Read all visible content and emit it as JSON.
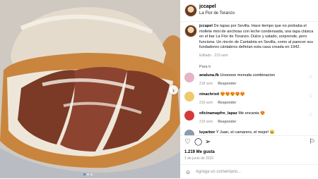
{
  "post": {
    "username": "jccapel",
    "location": "La Flor de Toranzo",
    "caption_user": "jccapel",
    "caption_text": "De tapas por Sevilla. Hace tiempo que no probaba el mollete mini de anchoas con leche condensada, una tapa clásica en el bar La Flor de Toranzo. Dulce y salado, sorprende, pero funciona. Un rincón de Cantabria en Sevilla, como al parecer sus fundadores cántabros definían esta casa creada en 1942.",
    "edited": "Editado · 219 sem",
    "translate": "Para ti",
    "likes": "1.219 Me gusta",
    "date": "1 de junio de 2022",
    "add_comment_placeholder": "Agrega un comentario..."
  },
  "comments": [
    {
      "user": "analuna.fb",
      "text": "Uoooooo menuda combinacion",
      "time": "218 sem",
      "reply": "Responder",
      "avatar_color": "#e7b3c8"
    },
    {
      "user": "ninachristi",
      "text": "😍😍😍😍😍",
      "time": "219 sem",
      "reply": "Responder",
      "avatar_color": "#f1c96a"
    },
    {
      "user": "oficinamapfre_lapaz",
      "text": "Me encanta 😍",
      "time": "219 sem",
      "reply": "Responder",
      "avatar_color": "#d33a3a"
    },
    {
      "user": "luyarbor",
      "text": "Y Juan, el camarero, el mejor! 😄",
      "time": "",
      "reply": "",
      "avatar_color": "#8a9ab0"
    }
  ],
  "icons": {
    "heart": "heart-icon",
    "comment": "comment-icon",
    "share": "share-icon",
    "save": "bookmark-icon",
    "emoji": "emoji-icon",
    "next": "chevron-right-icon"
  }
}
